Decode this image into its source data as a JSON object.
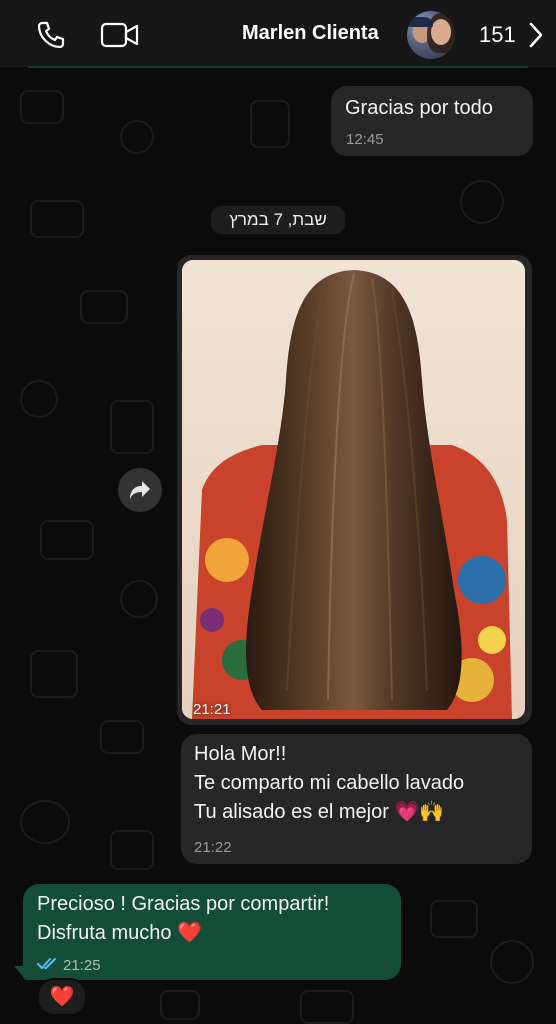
{
  "header": {
    "contact_name": "Marlen Clienta",
    "unread_count": "151",
    "icons": [
      "phone-icon",
      "video-icon",
      "chevron-right-icon"
    ]
  },
  "messages": [
    {
      "direction": "outgoing",
      "text": "Gracias por todo",
      "time": "12:45"
    },
    {
      "direction": "incoming",
      "type": "image",
      "image_description": "Long straight brown hair seen from behind",
      "time": "21:21"
    },
    {
      "direction": "incoming",
      "lines": [
        "Hola Mor!!",
        "Te comparto mi cabello lavado",
        "Tu alisado es el mejor"
      ],
      "emojis": "💗🙌",
      "time": "21:22"
    },
    {
      "direction": "outgoing",
      "lines": [
        "Precioso ! Gracias por compartir!",
        "Disfruta mucho"
      ],
      "emoji": "❤️",
      "time": "21:25",
      "status": "read",
      "reaction": "❤️"
    }
  ],
  "date_separator": "שבת, 7 במרץ",
  "colors": {
    "outgoing_bubble": "#134d37",
    "incoming_bubble": "#262626",
    "read_ticks": "#53bdeb",
    "background": "#0b0b0b"
  }
}
